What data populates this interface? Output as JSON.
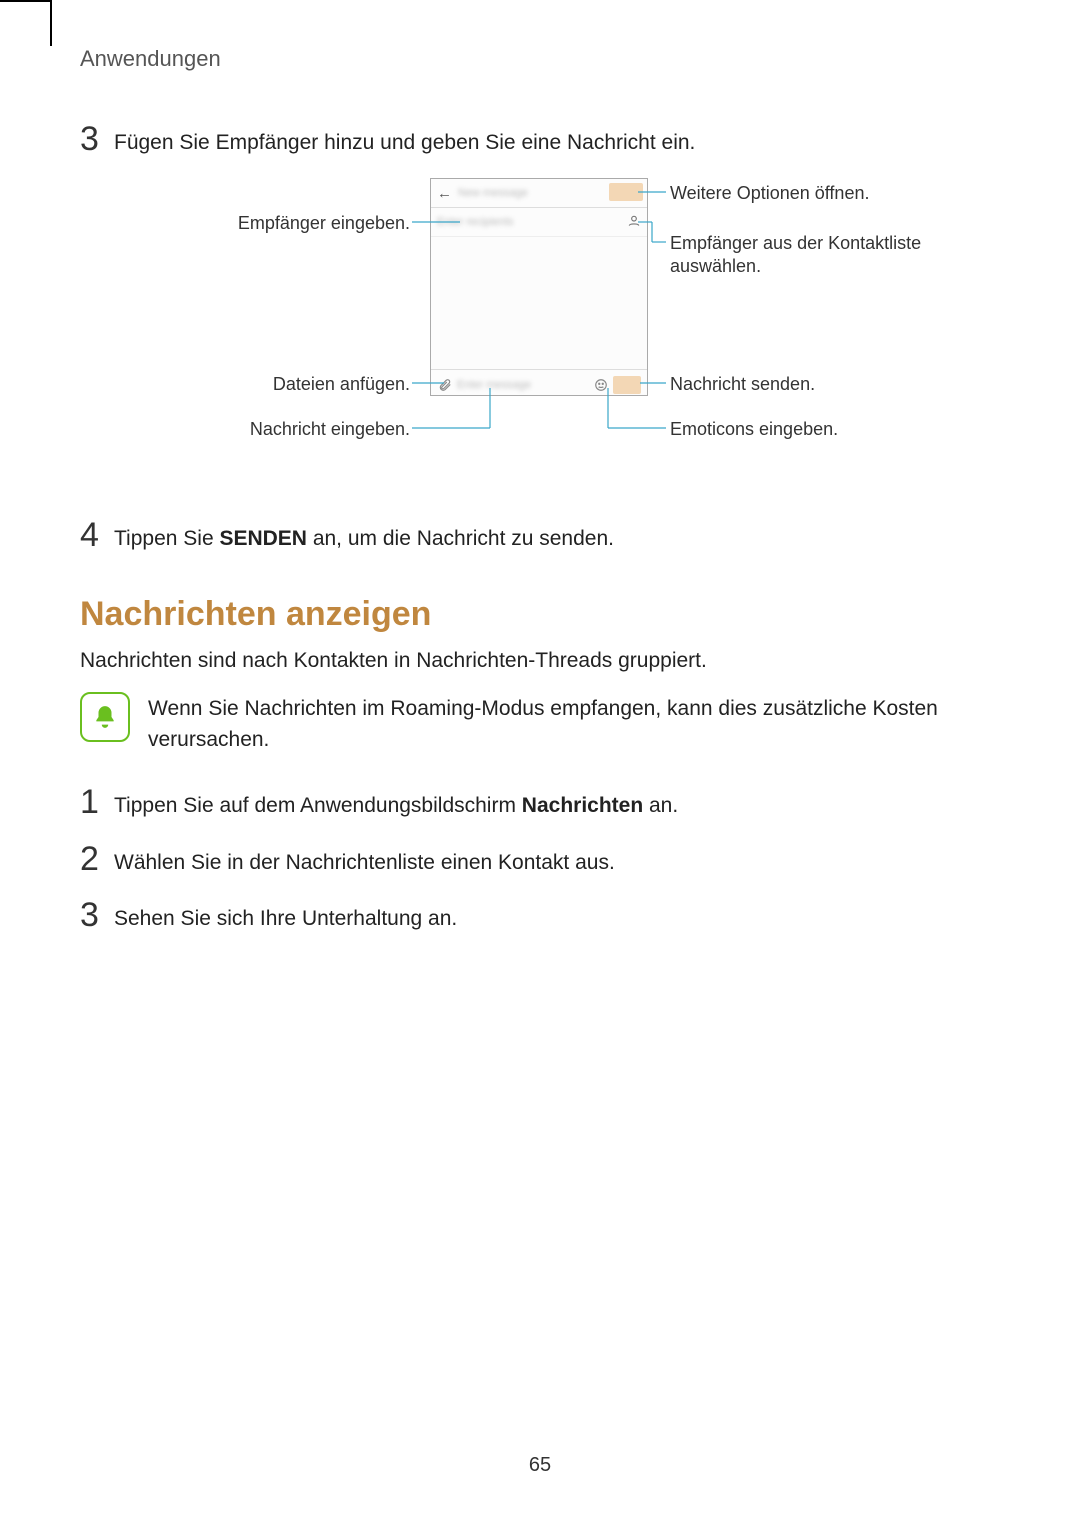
{
  "breadcrumb": "Anwendungen",
  "step3": {
    "num": "3",
    "text": "Fügen Sie Empfänger hinzu und geben Sie eine Nachricht ein."
  },
  "step4": {
    "num": "4",
    "text_before": "Tippen Sie ",
    "bold": "SENDEN",
    "text_after": " an, um die Nachricht zu senden."
  },
  "section_title": "Nachrichten anzeigen",
  "section_intro": "Nachrichten sind nach Kontakten in Nachrichten-Threads gruppiert.",
  "note_text": "Wenn Sie Nachrichten im Roaming-Modus empfangen, kann dies zusätzliche Kosten verursachen.",
  "list": {
    "s1": {
      "num": "1",
      "before": "Tippen Sie auf dem Anwendungsbildschirm ",
      "bold": "Nachrichten",
      "after": " an."
    },
    "s2": {
      "num": "2",
      "text": "Wählen Sie in der Nachrichtenliste einen Kontakt aus."
    },
    "s3": {
      "num": "3",
      "text": "Sehen Sie sich Ihre Unterhaltung an."
    }
  },
  "callouts": {
    "left": {
      "recipient": "Empfänger eingeben.",
      "attach": "Dateien anfügen.",
      "message": "Nachricht eingeben."
    },
    "right": {
      "more": "Weitere Optionen öffnen.",
      "contacts": "Empfänger aus der Kontaktliste auswählen.",
      "send": "Nachricht senden.",
      "emoji": "Emoticons eingeben."
    }
  },
  "diagram_placeholders": {
    "header_title": "New message",
    "recipient_hint": "Enter recipients",
    "input_hint": "Enter message"
  },
  "page_number": "65"
}
